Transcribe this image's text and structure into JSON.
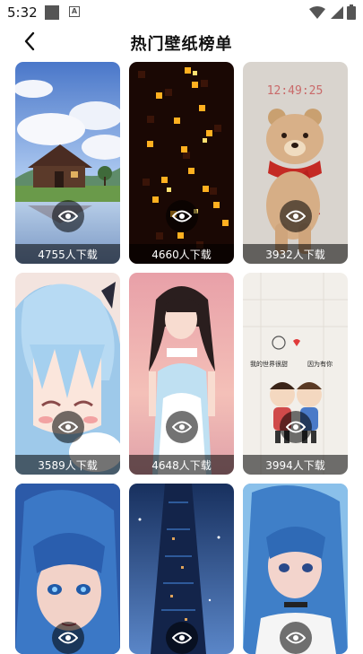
{
  "status_bar": {
    "time": "5:32"
  },
  "header": {
    "title": "热门壁纸榜单"
  },
  "wallpapers": [
    {
      "downloads": "4755人下载",
      "subject": "cabin-landscape"
    },
    {
      "downloads": "4660人下载",
      "subject": "glowing-squares"
    },
    {
      "downloads": "3932人下载",
      "subject": "bear-with-scarf"
    },
    {
      "downloads": "3589人下载",
      "subject": "anime-blue-hair-girl"
    },
    {
      "downloads": "4648人下载",
      "subject": "girl-in-maid-dress"
    },
    {
      "downloads": "3994人下载",
      "subject": "cartoon-couple"
    },
    {
      "downloads": "",
      "subject": "anime-portrait-blue-hair"
    },
    {
      "downloads": "",
      "subject": "night-tower"
    },
    {
      "downloads": "",
      "subject": "anime-girl-blue"
    }
  ],
  "bear_wallpaper": {
    "clock": "12:49:25"
  },
  "couple_wallpaper": {
    "left_text": "我的世界很甜",
    "right_text": "因为有你"
  },
  "colors": {
    "overlay": "rgba(0,0,0,0.55)",
    "text": "#111111"
  }
}
